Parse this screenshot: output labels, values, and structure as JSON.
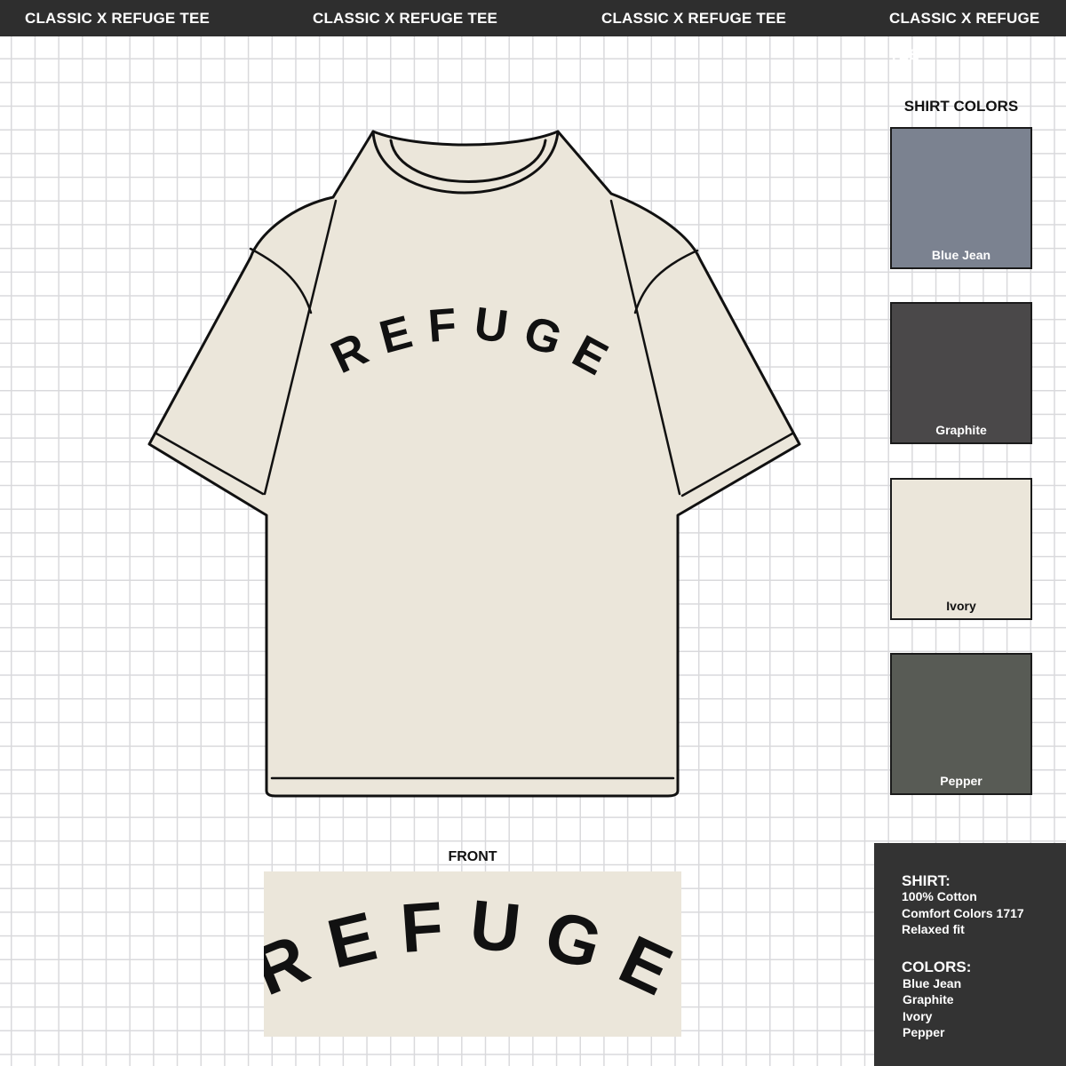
{
  "banner": {
    "items": [
      "CLASSIC X REFUGE TEE",
      "CLASSIC X REFUGE TEE",
      "CLASSIC X REFUGE TEE",
      "CLASSIC X REFUGE TEE"
    ]
  },
  "shirt": {
    "print_text": "REFUGE",
    "body_color": "#ebe6da",
    "outline_color": "#111111"
  },
  "shirt_colors": {
    "heading": "SHIRT COLORS",
    "swatches": [
      {
        "label": "Blue Jean",
        "color": "#7b8290",
        "label_color": "#ffffff"
      },
      {
        "label": "Graphite",
        "color": "#4a4849",
        "label_color": "#ffffff"
      },
      {
        "label": "Ivory",
        "color": "#ebe6da",
        "label_color": "#111111"
      },
      {
        "label": "Pepper",
        "color": "#585b55",
        "label_color": "#ffffff"
      }
    ]
  },
  "front": {
    "label": "FRONT",
    "print_text": "REFUGE"
  },
  "specs": {
    "shirt_heading": "SHIRT:",
    "shirt_lines": [
      "100% Cotton",
      "Comfort Colors 1717",
      "Relaxed fit"
    ],
    "colors_heading": "COLORS:",
    "color_lines": [
      "Blue Jean",
      "Graphite",
      "Ivory",
      "Pepper"
    ]
  }
}
